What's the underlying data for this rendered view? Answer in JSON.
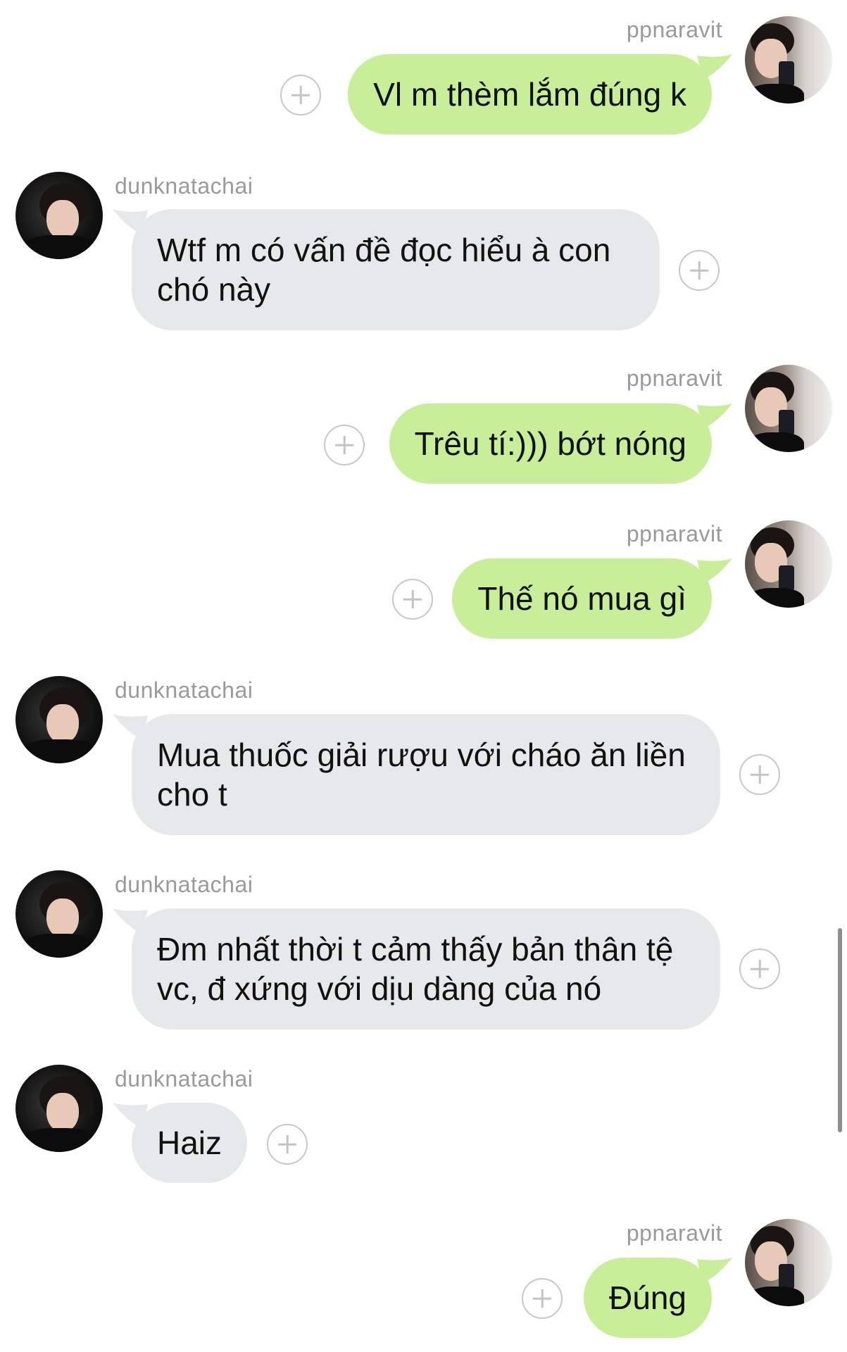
{
  "messages": [
    {
      "sender": "ppnaravit",
      "side": "out",
      "text": "Vl m thèm lắm đúng k"
    },
    {
      "sender": "dunknatachai",
      "side": "in",
      "text": "Wtf m có vấn đề đọc hiểu à con chó này"
    },
    {
      "sender": "ppnaravit",
      "side": "out",
      "text": "Trêu tí:))) bớt nóng"
    },
    {
      "sender": "ppnaravit",
      "side": "out",
      "text": "Thế nó mua gì"
    },
    {
      "sender": "dunknatachai",
      "side": "in",
      "text": "Mua thuốc giải rượu với cháo ăn liền cho t"
    },
    {
      "sender": "dunknatachai",
      "side": "in",
      "text": "Đm nhất thời t cảm thấy bản thân tệ vc, đ xứng với dịu dàng của nó"
    },
    {
      "sender": "dunknatachai",
      "side": "in",
      "text": "Haiz"
    },
    {
      "sender": "ppnaravit",
      "side": "out",
      "text": "Đúng"
    }
  ],
  "icons": {
    "add": "plus-circle-icon",
    "avatar": "profile-photo"
  },
  "colors": {
    "outgoing_bubble": "#c8ee9a",
    "incoming_bubble": "#e6e8ea",
    "username": "#9a9a9a",
    "background": "#ffffff"
  }
}
